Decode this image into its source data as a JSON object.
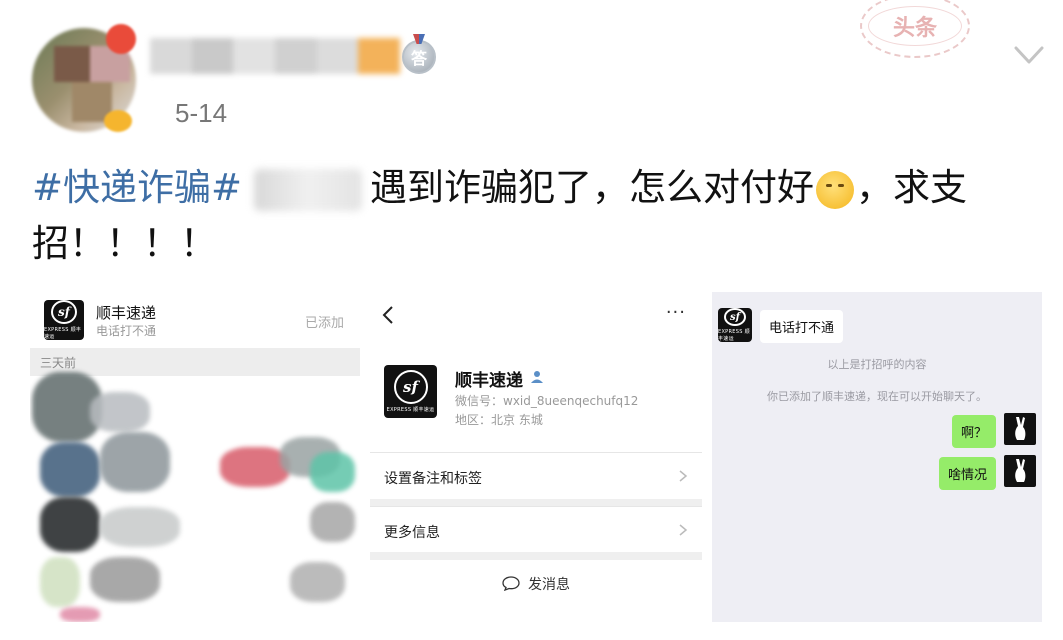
{
  "post": {
    "date": "5-14",
    "answer_badge": "答",
    "stamp_text": "头条",
    "hashtag": "#快递诈骗#",
    "text_line1": "遇到诈骗犯了，怎么对付好",
    "text_after_emoji": "，求支",
    "text_line2": "招！！！！"
  },
  "contact_list": {
    "name": "顺丰速递",
    "status": "电话打不通",
    "added_label": "已添加",
    "section_label": "三天前",
    "logo_text": "sf",
    "logo_tag": "EXPRESS 顺丰速运"
  },
  "profile": {
    "name": "顺丰速递",
    "wechat_id": "微信号：wxid_8ueenqechufq12",
    "region": "地区：北京  东城",
    "menu_dots": "···",
    "row_remark": "设置备注和标签",
    "row_more": "更多信息",
    "send_message": "发消息",
    "logo_text": "sf",
    "logo_tag": "EXPRESS 顺丰速运"
  },
  "chat": {
    "incoming": "电话打不通",
    "system_1": "以上是打招呼的内容",
    "system_2": "你已添加了顺丰速递，现在可以开始聊天了。",
    "outgoing_1": "啊？",
    "outgoing_2": "啥情况",
    "logo_text": "sf",
    "logo_tag": "EXPRESS 顺丰速运"
  },
  "icons": {
    "chevron": "chevron-down-icon",
    "back": "back-arrow-icon",
    "chat": "chat-bubble-icon",
    "person": "person-icon"
  },
  "colors": {
    "hashtag": "#3e6ea5",
    "sent_bubble": "#95ec69",
    "chat_bg": "#eeeef4"
  }
}
